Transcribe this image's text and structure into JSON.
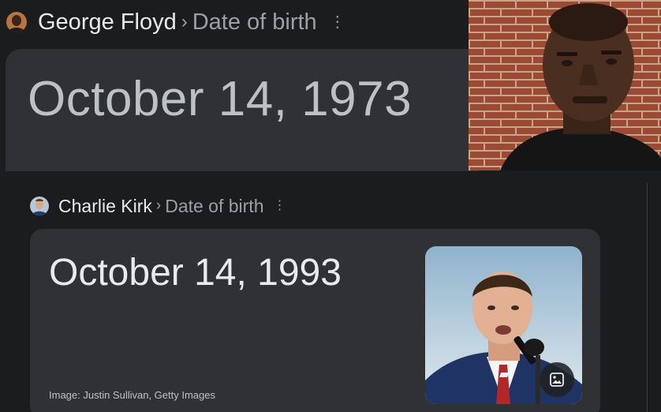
{
  "first_result": {
    "entity": "George Floyd",
    "separator": "›",
    "attribute": "Date of birth",
    "menu_glyph": "⋮",
    "answer": "October 14, 1973",
    "avatar_icon": "person-thumbnail-icon",
    "photo": "portrait-photo"
  },
  "second_result": {
    "entity": "Charlie Kirk",
    "separator": "›",
    "attribute": "Date of birth",
    "menu_glyph": "⋮",
    "answer": "October 14, 1993",
    "image_credit": "Image: Justin Sullivan, Getty Images",
    "avatar_icon": "person-thumbnail-icon",
    "photo": "speaker-photo",
    "image_button_icon": "image-icon"
  },
  "colors": {
    "page_background": "#1b1c1e",
    "card_background": "#303134",
    "primary_text": "#e8eaed",
    "secondary_text": "#9aa0a6"
  }
}
